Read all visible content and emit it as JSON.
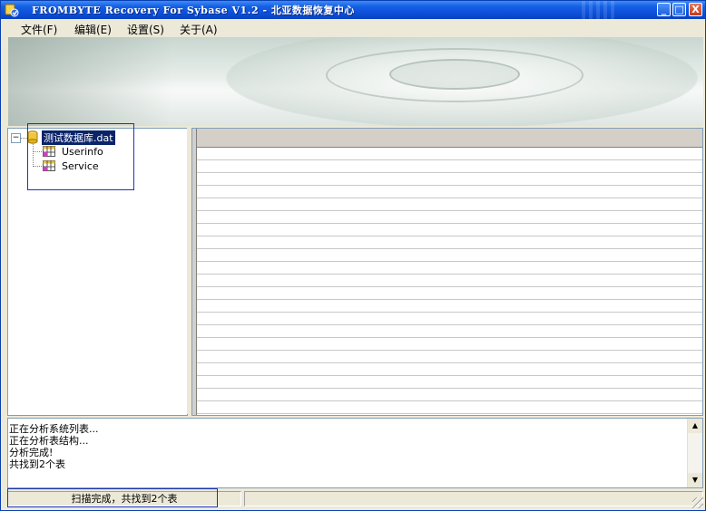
{
  "window": {
    "title": "FROMBYTE Recovery For Sybase V1.2 - 北亚数据恢复中心",
    "controls": {
      "minimize": "_",
      "maximize": "□",
      "close": "X"
    }
  },
  "menu": [
    {
      "label": "文件(F)"
    },
    {
      "label": "编辑(E)"
    },
    {
      "label": "设置(S)"
    },
    {
      "label": "关于(A)"
    }
  ],
  "tree": {
    "expander": "−",
    "root": {
      "label": "测试数据库.dat",
      "icon": "database-icon",
      "selected": true
    },
    "children": [
      {
        "label": "Userinfo",
        "icon": "table-icon"
      },
      {
        "label": "Service",
        "icon": "table-icon"
      }
    ]
  },
  "log": {
    "lines": [
      "正在分析系统列表...",
      "正在分析表结构...",
      "分析完成!",
      "共找到2个表"
    ]
  },
  "scrollbar": {
    "up": "▲",
    "down": "▼"
  },
  "status": {
    "message": "扫描完成，共找到2个表",
    "secondary": ""
  },
  "colors": {
    "titlebar": "#0b4fd8",
    "selection": "#0a246a",
    "highlight_box": "#1c35b4"
  }
}
